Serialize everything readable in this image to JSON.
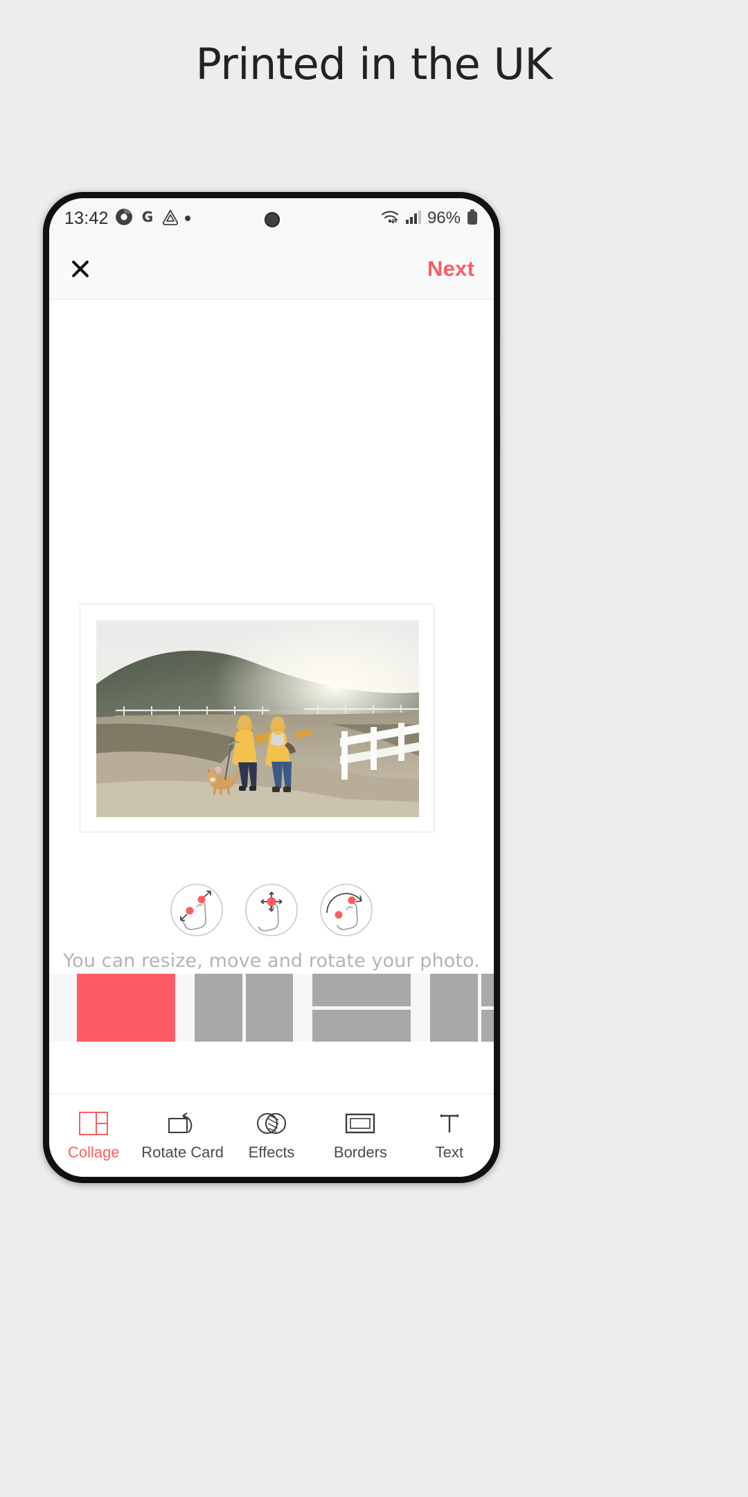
{
  "headline": "Printed in the UK",
  "statusbar": {
    "time": "13:42",
    "notification_icons": [
      "chrome-icon",
      "google-icon",
      "drive-icon",
      "dot-icon"
    ],
    "wifi_icon": "wifi-icon",
    "signal_icon": "cellular-signal-icon",
    "battery_percent": "96%",
    "battery_icon": "battery-full-icon"
  },
  "appbar": {
    "close_icon": "close-icon",
    "next_label": "Next"
  },
  "canvas": {
    "photo_alt": "two people in yellow coats running with a dog on a coastal path",
    "hint_text": "You can resize, move and rotate your photo.",
    "gesture_icons": [
      "pinch-resize-gesture-icon",
      "move-gesture-icon",
      "rotate-gesture-icon"
    ]
  },
  "layouts": [
    {
      "name": "single",
      "selected": true,
      "columns": [
        [
          1
        ]
      ]
    },
    {
      "name": "two-columns",
      "selected": false,
      "columns": [
        [
          1
        ],
        [
          1
        ]
      ]
    },
    {
      "name": "two-rows",
      "selected": false,
      "columns": [
        [
          1,
          1
        ]
      ]
    },
    {
      "name": "left-full-right-split",
      "selected": false,
      "columns": [
        [
          1
        ],
        [
          1,
          1
        ]
      ]
    },
    {
      "name": "left-split-right-full",
      "selected": false,
      "columns": [
        [
          1,
          1
        ],
        [
          1
        ]
      ]
    }
  ],
  "bottomnav": [
    {
      "label": "Collage",
      "icon": "collage-icon",
      "active": true
    },
    {
      "label": "Rotate Card",
      "icon": "rotate-icon",
      "active": false
    },
    {
      "label": "Effects",
      "icon": "effects-icon",
      "active": false
    },
    {
      "label": "Borders",
      "icon": "borders-icon",
      "active": false
    },
    {
      "label": "Text",
      "icon": "text-icon",
      "active": false
    }
  ],
  "colors": {
    "accent": "#fc5c63",
    "page_background": "#ededed",
    "layout_cell": "#a8a8a8"
  }
}
